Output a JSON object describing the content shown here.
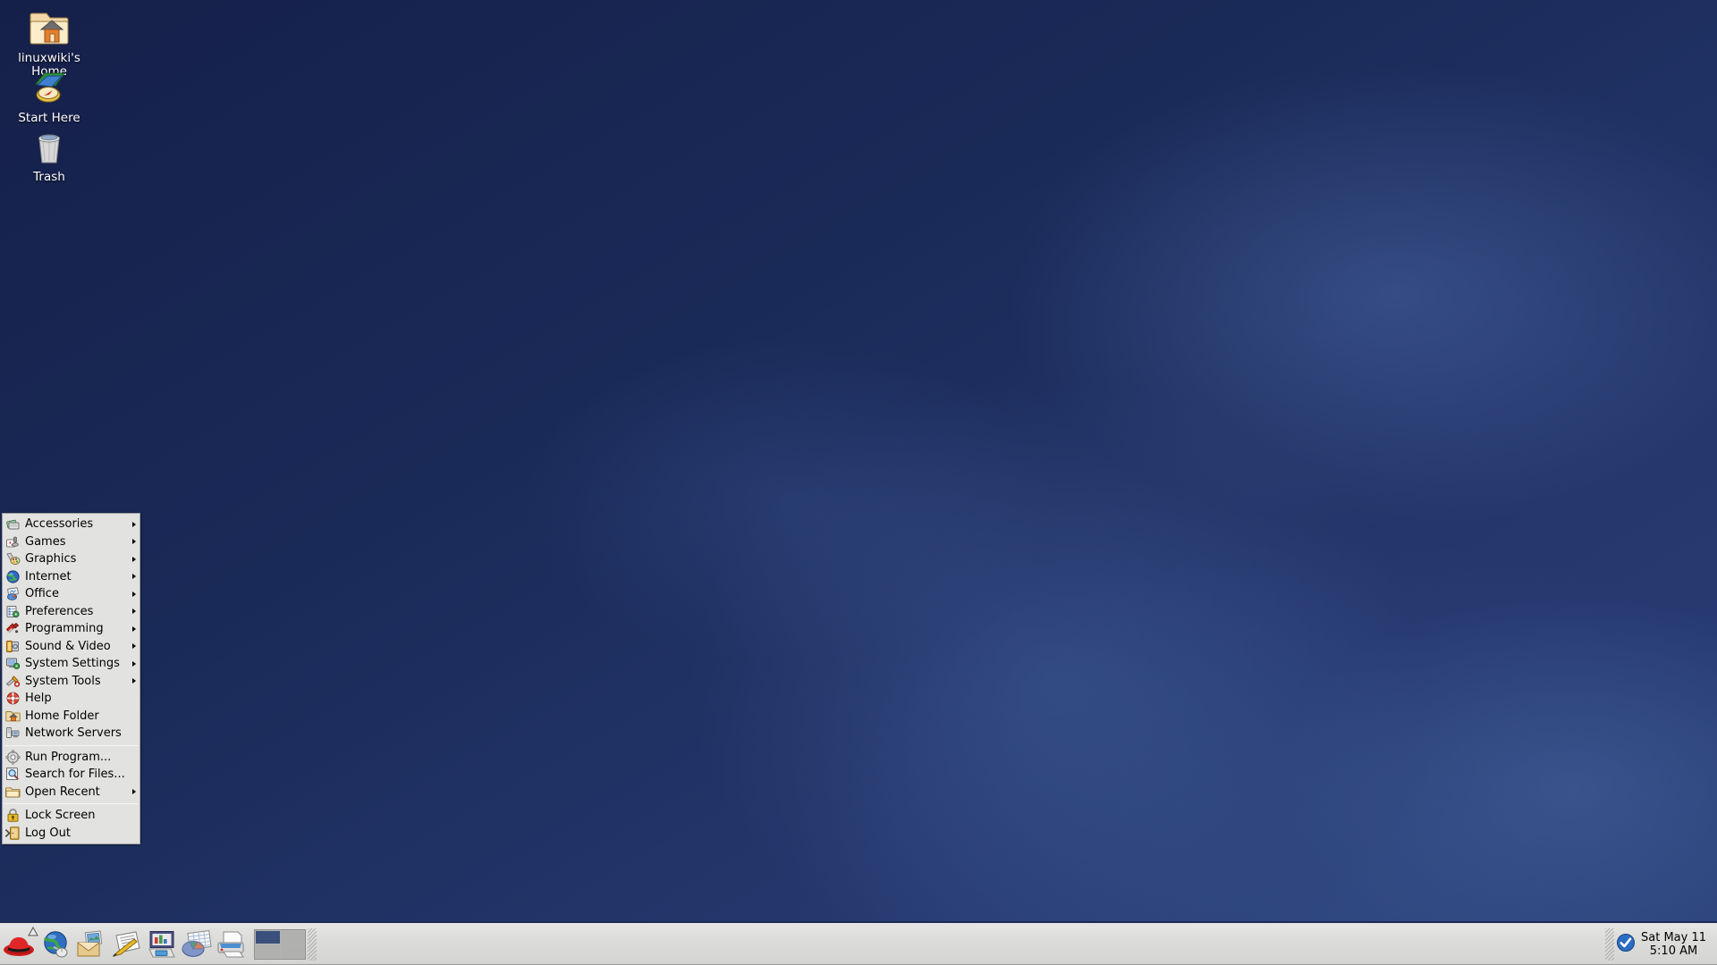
{
  "desktop": {
    "icons": [
      {
        "label": "linuxwiki's Home",
        "icon": "home-folder-icon"
      },
      {
        "label": "Start Here",
        "icon": "start-here-icon"
      },
      {
        "label": "Trash",
        "icon": "trash-icon"
      }
    ],
    "wallpaper_color": "#1a2a58"
  },
  "menu": {
    "groups": [
      {
        "items": [
          {
            "label": "Accessories",
            "icon": "accessories-icon",
            "submenu": true
          },
          {
            "label": "Games",
            "icon": "games-icon",
            "submenu": true
          },
          {
            "label": "Graphics",
            "icon": "graphics-icon",
            "submenu": true
          },
          {
            "label": "Internet",
            "icon": "internet-icon",
            "submenu": true
          },
          {
            "label": "Office",
            "icon": "office-icon",
            "submenu": true
          },
          {
            "label": "Preferences",
            "icon": "preferences-icon",
            "submenu": true
          },
          {
            "label": "Programming",
            "icon": "programming-icon",
            "submenu": true
          },
          {
            "label": "Sound & Video",
            "icon": "sound-video-icon",
            "submenu": true
          },
          {
            "label": "System Settings",
            "icon": "system-settings-icon",
            "submenu": true
          },
          {
            "label": "System Tools",
            "icon": "system-tools-icon",
            "submenu": true
          },
          {
            "label": "Help",
            "icon": "help-icon",
            "submenu": false
          },
          {
            "label": "Home Folder",
            "icon": "home-folder-icon",
            "submenu": false
          },
          {
            "label": "Network Servers",
            "icon": "network-servers-icon",
            "submenu": false
          }
        ]
      },
      {
        "items": [
          {
            "label": "Run Program...",
            "icon": "run-program-icon",
            "submenu": false
          },
          {
            "label": "Search for Files...",
            "icon": "search-icon",
            "submenu": false
          },
          {
            "label": "Open Recent",
            "icon": "open-recent-icon",
            "submenu": true
          }
        ]
      },
      {
        "items": [
          {
            "label": "Lock Screen",
            "icon": "lock-screen-icon",
            "submenu": false
          },
          {
            "label": "Log Out",
            "icon": "log-out-icon",
            "submenu": false
          }
        ]
      }
    ]
  },
  "panel": {
    "launchers": [
      {
        "name": "main-menu-redhat",
        "title": "Applications Menu"
      },
      {
        "name": "web-browser",
        "title": "Web Browser"
      },
      {
        "name": "email-client",
        "title": "Email"
      },
      {
        "name": "word-processor",
        "title": "Word Processor"
      },
      {
        "name": "presentation",
        "title": "Presentation"
      },
      {
        "name": "spreadsheet",
        "title": "Spreadsheet"
      },
      {
        "name": "print-manager",
        "title": "Printing"
      }
    ],
    "workspaces": {
      "count": 4,
      "active_index": 0
    },
    "clock": {
      "date": "Sat May 11",
      "time": "5:10 AM",
      "icon": "update-ok-icon"
    }
  }
}
